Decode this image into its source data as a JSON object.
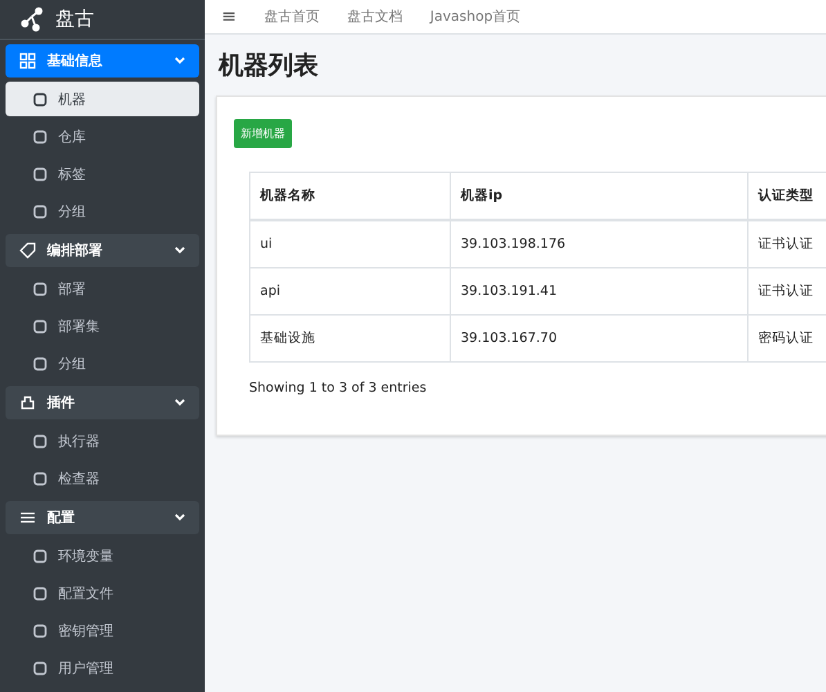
{
  "brand": {
    "name": "盘古"
  },
  "sidebar": {
    "groups": [
      {
        "label": "基础信息",
        "expanded": true,
        "selected": true,
        "children": [
          {
            "label": "机器",
            "selected": true
          },
          {
            "label": "仓库",
            "selected": false
          },
          {
            "label": "标签",
            "selected": false
          },
          {
            "label": "分组",
            "selected": false
          }
        ]
      },
      {
        "label": "编排部署",
        "expanded": true,
        "selected": false,
        "children": [
          {
            "label": "部署",
            "selected": false
          },
          {
            "label": "部署集",
            "selected": false
          },
          {
            "label": "分组",
            "selected": false
          }
        ]
      },
      {
        "label": "插件",
        "expanded": true,
        "selected": false,
        "children": [
          {
            "label": "执行器",
            "selected": false
          },
          {
            "label": "检查器",
            "selected": false
          }
        ]
      },
      {
        "label": "配置",
        "expanded": true,
        "selected": false,
        "children": [
          {
            "label": "环境变量",
            "selected": false
          },
          {
            "label": "配置文件",
            "selected": false
          },
          {
            "label": "密钥管理",
            "selected": false
          },
          {
            "label": "用户管理",
            "selected": false
          }
        ]
      }
    ]
  },
  "topbar": {
    "menu_icon": "≡",
    "links": [
      "盘古首页",
      "盘古文档",
      "Javashop首页"
    ]
  },
  "page": {
    "title": "机器列表",
    "add_button": "新增机器"
  },
  "table": {
    "columns": [
      "机器名称",
      "机器ip",
      "认证类型"
    ],
    "rows": [
      [
        "ui",
        "39.103.198.176",
        "证书认证"
      ],
      [
        "api",
        "39.103.191.41",
        "证书认证"
      ],
      [
        "基础设施",
        "39.103.167.70",
        "密码认证"
      ]
    ],
    "footer": "Showing 1 to 3 of 3 entries"
  }
}
